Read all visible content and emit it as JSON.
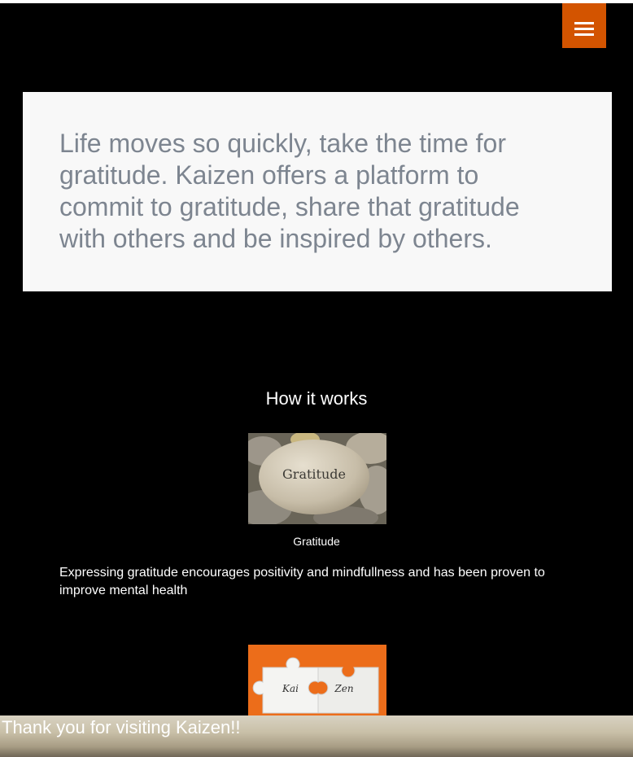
{
  "header": {
    "menu_icon": "hamburger-icon",
    "menu_color": "#d35400"
  },
  "hero": {
    "text": "Life moves so quickly, take the time for gratitude. Kaizen offers a platform to commit to gratitude, share that gratitude with others and be inspired by others."
  },
  "how_it_works": {
    "title": "How it works",
    "items": [
      {
        "image_text": "Gratitude",
        "caption": "Gratitude",
        "description": "Expressing gratitude encourages positivity and mindfullness and has been proven to improve mental health"
      },
      {
        "image_text_left": "Kai",
        "image_text_right": "Zen"
      }
    ]
  },
  "footer": {
    "text": "Thank you for visiting Kaizen!!"
  }
}
